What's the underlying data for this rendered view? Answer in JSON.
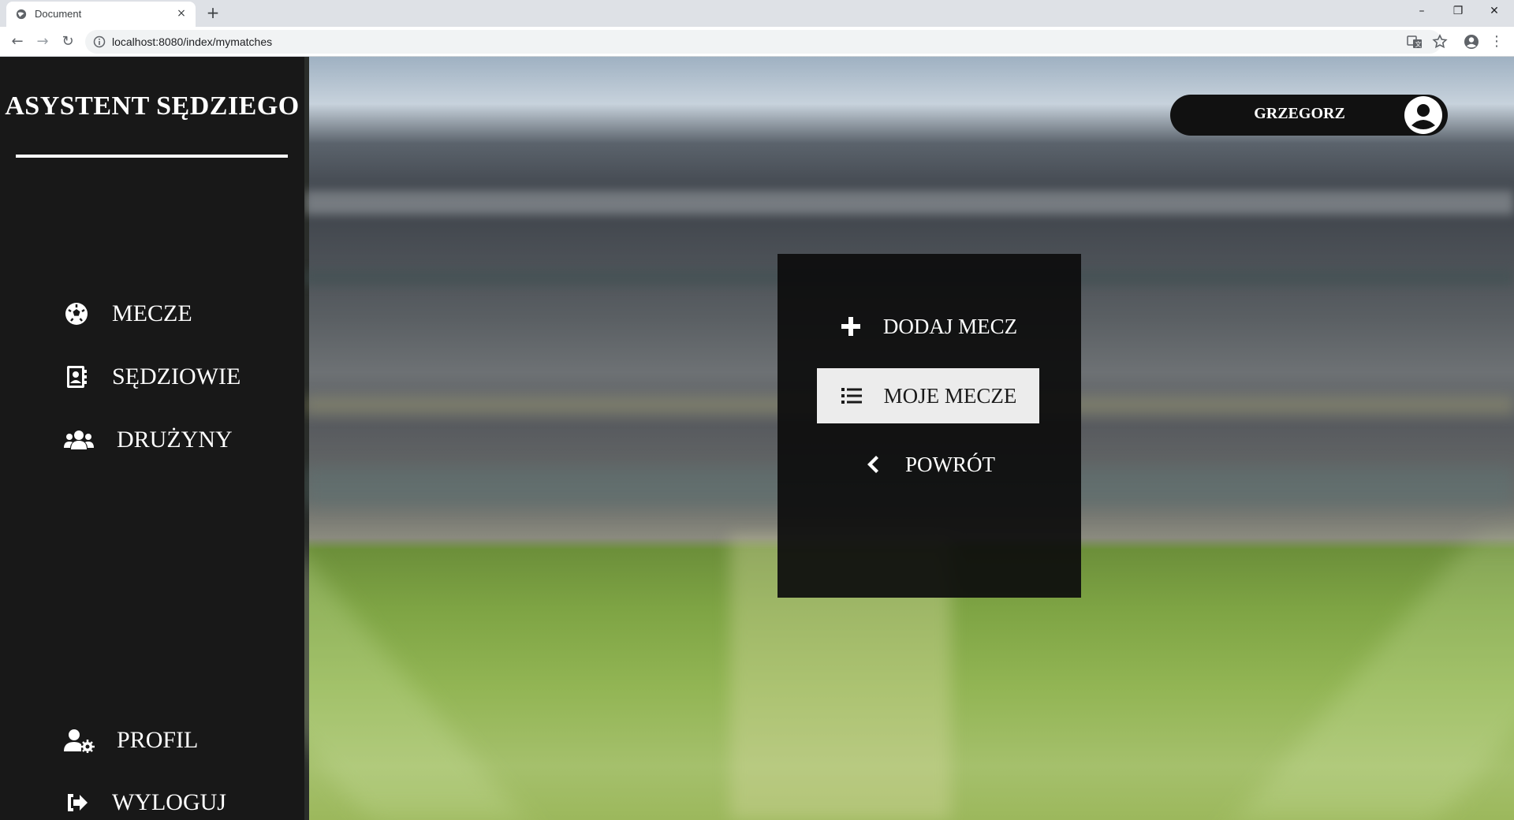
{
  "browser": {
    "tab_title": "Document",
    "tab_close": "×",
    "new_tab": "+",
    "url": "localhost:8080/index/mymatches",
    "minimize": "–",
    "maximize": "❐",
    "close": "✕",
    "back": "←",
    "forward": "→",
    "reload": "↻",
    "menu": "⋮"
  },
  "sidebar": {
    "brand": "ASYSTENT SĘDZIEGO",
    "items": [
      {
        "label": "MECZE",
        "icon": "soccer-ball-icon"
      },
      {
        "label": "SĘDZIOWIE",
        "icon": "contact-card-icon"
      },
      {
        "label": "DRUŻYNY",
        "icon": "users-icon"
      }
    ],
    "bottom_items": [
      {
        "label": "PROFIL",
        "icon": "user-cog-icon"
      },
      {
        "label": "WYLOGUJ",
        "icon": "sign-out-icon"
      }
    ]
  },
  "user": {
    "name": "GRZEGORZ",
    "icon": "user-circle-icon"
  },
  "panel": {
    "buttons": [
      {
        "label": "DODAJ MECZ",
        "icon": "plus-icon"
      },
      {
        "label": "MOJE MECZE",
        "icon": "list-icon"
      },
      {
        "label": "POWRÓT",
        "icon": "chevron-left-icon"
      }
    ]
  },
  "colors": {
    "sidebar_bg": "#181818",
    "panel_bg": "#0c0c0c",
    "active_button_bg": "#ececec",
    "text": "#ffffff"
  }
}
